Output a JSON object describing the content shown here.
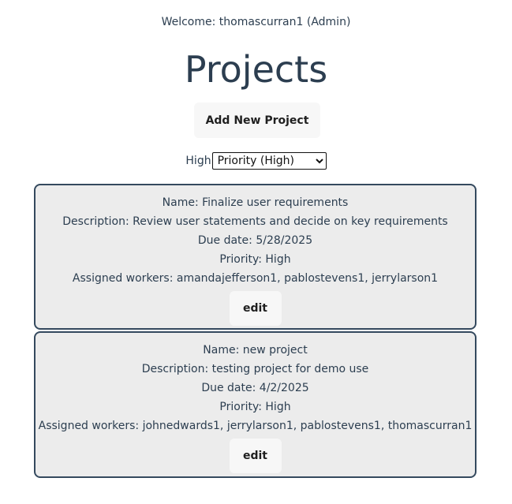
{
  "header": {
    "welcome": "Welcome: thomascurran1 (Admin)",
    "title": "Projects",
    "add_button": "Add New Project"
  },
  "filter": {
    "label": "High",
    "selected": "Priority (High)",
    "options": [
      "Priority (High)"
    ]
  },
  "projects": [
    {
      "name": "Name: Finalize user requirements",
      "description": "Description: Review user statements and decide on key requirements",
      "due_date": "Due date: 5/28/2025",
      "priority": "Priority: High",
      "workers": "Assigned workers: amandajefferson1, pablostevens1, jerrylarson1",
      "edit_label": "edit"
    },
    {
      "name": "Name: new project",
      "description": "Description: testing project for demo use",
      "due_date": "Due date: 4/2/2025",
      "priority": "Priority: High",
      "workers": "Assigned workers: johnedwards1, jerrylarson1, pablostevens1, thomascurran1",
      "edit_label": "edit"
    }
  ],
  "colors": {
    "text": "#2c3e50",
    "card_background": "#ececec",
    "card_border": "#34495e",
    "button_background": "#f7f7f7"
  }
}
